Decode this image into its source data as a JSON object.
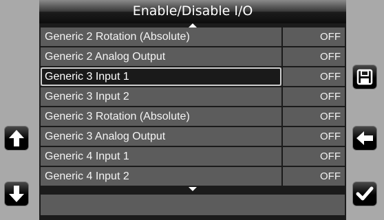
{
  "header": {
    "title": "Enable/Disable I/O"
  },
  "list": {
    "items": [
      {
        "name": "Generic 2 Rotation (Absolute)",
        "value": "OFF",
        "selected": false
      },
      {
        "name": "Generic 2 Analog Output",
        "value": "OFF",
        "selected": false
      },
      {
        "name": "Generic 3 Input 1",
        "value": "OFF",
        "selected": true
      },
      {
        "name": "Generic 3 Input 2",
        "value": "OFF",
        "selected": false
      },
      {
        "name": "Generic 3 Rotation (Absolute)",
        "value": "OFF",
        "selected": false
      },
      {
        "name": "Generic 3 Analog Output",
        "value": "OFF",
        "selected": false
      },
      {
        "name": "Generic 4 Input 1",
        "value": "OFF",
        "selected": false
      },
      {
        "name": "Generic 4 Input 2",
        "value": "OFF",
        "selected": false
      }
    ]
  },
  "icons": {
    "up": "arrow-up-icon",
    "down": "arrow-down-icon",
    "save": "floppy-disk-icon",
    "back": "arrow-left-icon",
    "ok": "checkmark-icon"
  },
  "colors": {
    "background": "#a9a9a9",
    "panel": "#1b1b1b",
    "row": "#5c5c5c",
    "text": "#f4f4f4"
  }
}
